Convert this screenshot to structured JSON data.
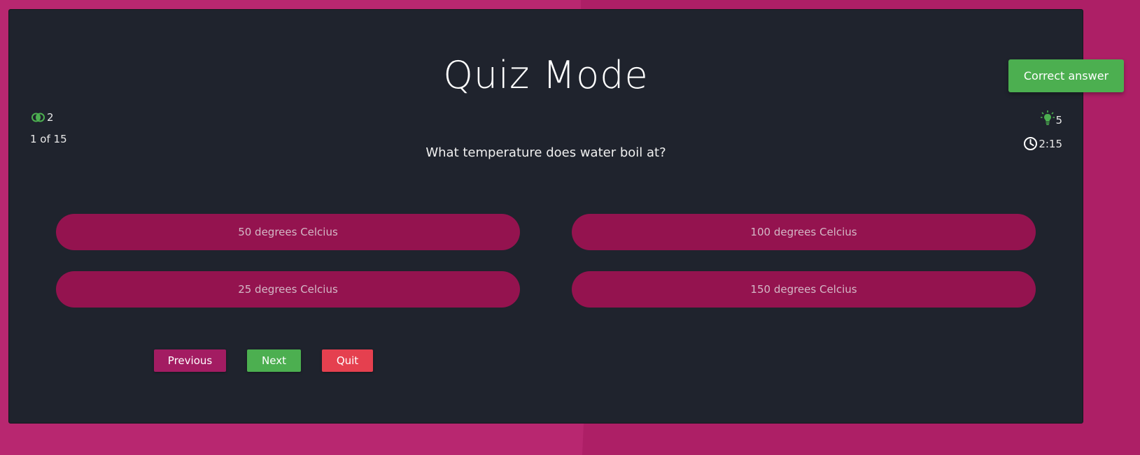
{
  "page": {
    "title": "Quiz Mode",
    "question": "What temperature does water boil at?"
  },
  "status": {
    "lives": "2",
    "progress": "1 of 15",
    "hints": "5",
    "timer": "2:15"
  },
  "options": [
    {
      "label": "50 degrees Celcius"
    },
    {
      "label": "100 degrees Celcius"
    },
    {
      "label": "25 degrees Celcius"
    },
    {
      "label": "150 degrees Celcius"
    }
  ],
  "controls": {
    "previous": "Previous",
    "next": "Next",
    "quit": "Quit"
  },
  "toast": {
    "message": "Correct answer"
  },
  "icons": {
    "lives": "lives-rings-icon",
    "hints": "lightbulb-icon",
    "timer": "clock-icon"
  },
  "colors": {
    "background": "#b82770",
    "panel": "#1f232d",
    "option": "#94134f",
    "previous": "#a31c62",
    "next": "#4caf50",
    "quit": "#e5404f",
    "toast": "#4caf50",
    "accent_icon": "#4caf50"
  }
}
